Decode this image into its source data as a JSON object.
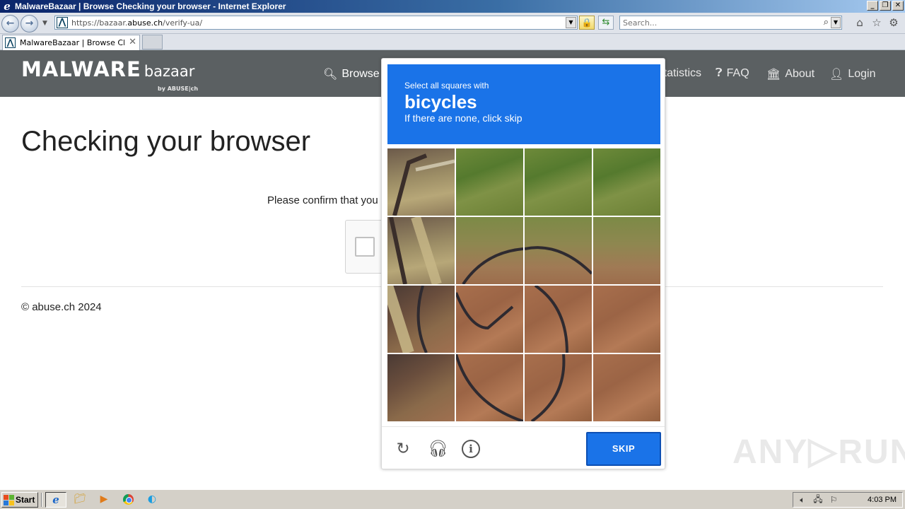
{
  "window": {
    "title": "MalwareBazaar | Browse Checking your browser - Internet Explorer",
    "controls": {
      "minimize": "_",
      "restore": "❐",
      "close": "✕"
    }
  },
  "browser": {
    "url_prefix": "https://bazaar.",
    "url_host": "abuse.ch",
    "url_path": "/verify-ua/",
    "search_placeholder": "Search...",
    "tab_title": "MalwareBazaar | Browse Ch...",
    "icons": {
      "back": "back-arrow-icon",
      "forward": "forward-arrow-icon",
      "home": "home-icon",
      "favorites": "star-icon",
      "tools": "gear-icon"
    }
  },
  "site": {
    "brand_main": "MALWARE",
    "brand_sub": "bazaar",
    "brand_by": "by ABUSE|ch",
    "nav": {
      "browse": "Browse",
      "statistics": "Statistics",
      "faq": "FAQ",
      "about": "About",
      "login": "Login"
    }
  },
  "page": {
    "title": "Checking your browser",
    "confirm_text": "Please confirm that you are human",
    "footer": "© abuse.ch 2024"
  },
  "challenge": {
    "prompt_top": "Select all squares with",
    "prompt_main": "bicycles",
    "prompt_bottom": "If there are none, click skip",
    "skip_label": "SKIP",
    "accent_color": "#1a73e8",
    "grid_rows": 4,
    "grid_cols": 4
  },
  "watermark": {
    "text_left": "ANY",
    "text_right": "RUN"
  },
  "taskbar": {
    "start_label": "Start",
    "clock": "4:03 PM"
  }
}
